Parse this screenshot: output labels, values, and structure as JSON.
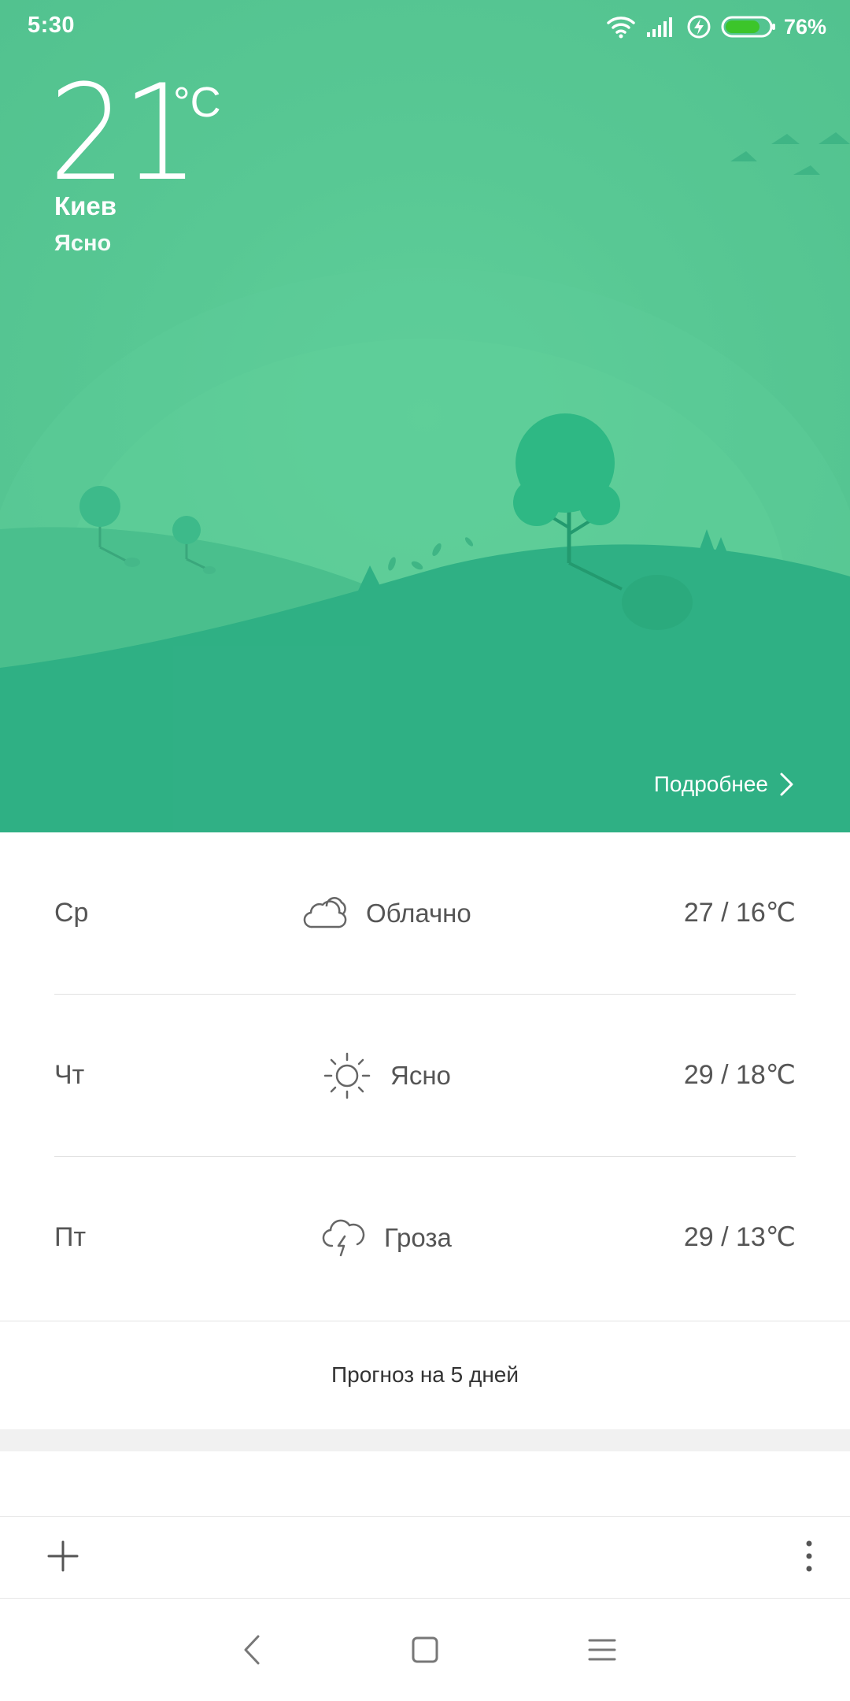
{
  "status_bar": {
    "time": "5:30",
    "battery_percent": "76%",
    "battery_level": 0.76,
    "icons": [
      "wifi-icon",
      "signal-icon",
      "charging-icon",
      "battery-icon"
    ]
  },
  "current": {
    "temperature": "21",
    "unit": "°C",
    "city": "Киев",
    "condition": "Ясно"
  },
  "details_label": "Подробнее",
  "forecast": [
    {
      "day": "Ср",
      "icon": "cloud-icon",
      "condition": "Облачно",
      "temps": "27 / 16℃"
    },
    {
      "day": "Чт",
      "icon": "sun-icon",
      "condition": "Ясно",
      "temps": "29 / 18℃"
    },
    {
      "day": "Пт",
      "icon": "thunderstorm-icon",
      "condition": "Гроза",
      "temps": "29 / 13℃"
    }
  ],
  "five_day_label": "Прогноз на 5 дней",
  "colors": {
    "hero_green": "#58c894",
    "hill_front": "#2fb084",
    "hill_mid": "#3dba8a",
    "tree_green": "#2eb884",
    "text_gray": "#555555",
    "battery_green": "#3cc52a"
  }
}
